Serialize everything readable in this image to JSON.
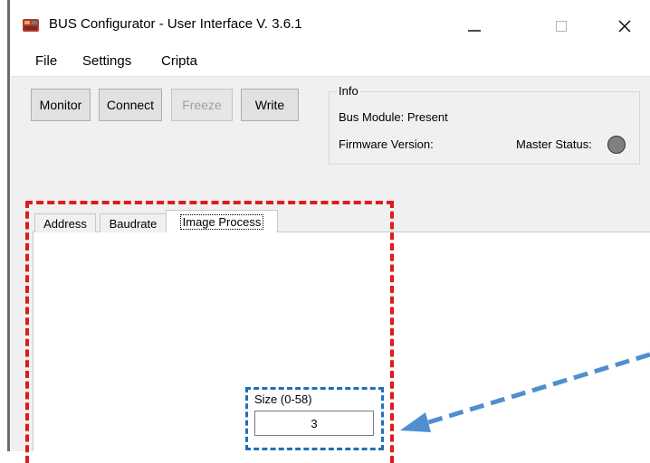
{
  "window": {
    "title": "BUS Configurator - User Interface  V. 3.6.1",
    "controls": {
      "minimize": "—",
      "maximize": "☐",
      "close": "✕"
    }
  },
  "menu": [
    "File",
    "Settings",
    "Cripta"
  ],
  "toolbar": {
    "monitor": "Monitor",
    "connect": "Connect",
    "freeze": "Freeze",
    "write": "Write"
  },
  "info": {
    "legend": "Info",
    "bus_module": "Bus Module: Present",
    "firmware": "Firmware Version:",
    "master_status": "Master Status:",
    "master_status_color": "#808080"
  },
  "tabs": [
    "Address",
    "Baudrate",
    "Image Process"
  ],
  "active_tab": "Image Process",
  "image_process": {
    "size_label": "Size (0-58)",
    "size_value": "3"
  },
  "annotations": {
    "red_box_color": "#e01a1a",
    "blue_box_color": "#1f6fb8"
  },
  "icons": {
    "app": "app-icon",
    "status": "status-led-icon"
  }
}
